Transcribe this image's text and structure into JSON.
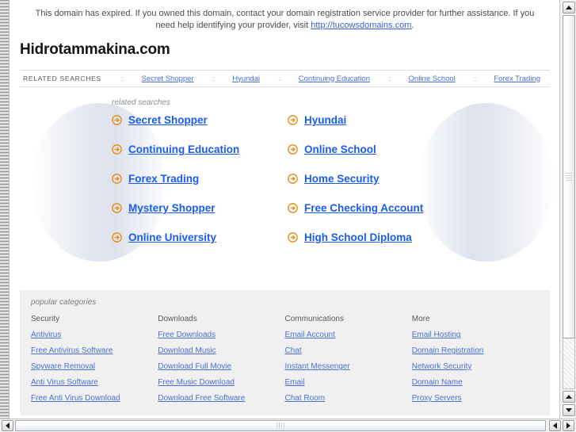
{
  "banner": {
    "text_before": "This domain has expired. If you owned this domain, contact your domain registration service provider for further assistance. If you need help identifying your provider, visit ",
    "link_text": "http://tucowsdomains.com",
    "text_after": "."
  },
  "domain_title": "Hidrotammakina.com",
  "related_searches_bar": {
    "label": "RELATED SEARCHES",
    "separator": "::",
    "links": [
      "Secret Shopper",
      "Hyundai",
      "Continuing Education",
      "Online School",
      "Forex Trading"
    ]
  },
  "hero": {
    "caption": "related searches",
    "icon_name": "orange-arrow-circle-icon",
    "links": [
      "Secret Shopper",
      "Hyundai",
      "Continuing Education",
      "Online School",
      "Forex Trading",
      "Home Security",
      "Mystery Shopper",
      "Free Checking Account",
      "Online University",
      "High School Diploma"
    ]
  },
  "popular_categories": {
    "caption": "popular categories",
    "columns": [
      {
        "heading": "Security",
        "links": [
          "Antivirus",
          "Free Antivirus Software",
          "Spyware Removal",
          "Anti Virus Software",
          "Free Anti Virus Download"
        ]
      },
      {
        "heading": "Downloads",
        "links": [
          "Free Downloads",
          "Download Music",
          "Download Full Movie",
          "Free Music Download",
          "Download Free Software"
        ]
      },
      {
        "heading": "Communications",
        "links": [
          "Email Account",
          "Chat",
          "Instant Messenger",
          "Email",
          "Chat Room"
        ]
      },
      {
        "heading": "More",
        "links": [
          "Email Hosting",
          "Domain Registration",
          "Network Security",
          "Domain Name",
          "Proxy Servers"
        ]
      }
    ]
  },
  "colors": {
    "link_blue": "#4a6fd8",
    "hero_link_blue": "#1a5cf0",
    "arrow_orange": "#e8890c",
    "category_panel_bg": "#f0f0f0",
    "caption_gray": "#8e8e8e"
  },
  "scrollbars": {
    "vertical": {
      "up_icon": "triangle-up-icon",
      "down_icon": "triangle-down-icon"
    },
    "horizontal": {
      "left_icon": "triangle-left-icon",
      "right_icon": "triangle-right-icon"
    }
  }
}
